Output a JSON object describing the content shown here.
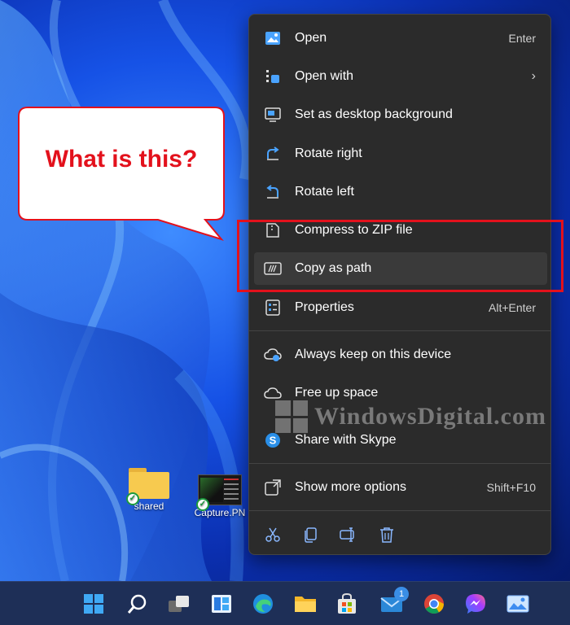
{
  "callout": {
    "text": "What is this?"
  },
  "desktop_icons": [
    {
      "label": "shared",
      "icon": "folder-icon"
    },
    {
      "label": "Capture.PN",
      "icon": "image-thumbnail-icon"
    }
  ],
  "context_menu": {
    "items": [
      {
        "label": "Open",
        "shortcut": "Enter",
        "icon": "image-icon"
      },
      {
        "label": "Open with",
        "shortcut": "",
        "icon": "open-with-icon",
        "submenu": true
      },
      {
        "label": "Set as desktop background",
        "shortcut": "",
        "icon": "desktop-background-icon"
      },
      {
        "label": "Rotate right",
        "shortcut": "",
        "icon": "rotate-right-icon"
      },
      {
        "label": "Rotate left",
        "shortcut": "",
        "icon": "rotate-left-icon"
      },
      {
        "label": "Compress to ZIP file",
        "shortcut": "",
        "icon": "zip-icon"
      },
      {
        "label": "Copy as path",
        "shortcut": "",
        "icon": "copy-path-icon",
        "highlighted": true
      },
      {
        "label": "Properties",
        "shortcut": "Alt+Enter",
        "icon": "properties-icon"
      },
      {
        "label": "Always keep on this device",
        "shortcut": "",
        "icon": "cloud-keep-icon"
      },
      {
        "label": "Free up space",
        "shortcut": "",
        "icon": "cloud-icon"
      },
      {
        "label": "Share with Skype",
        "shortcut": "",
        "icon": "skype-icon"
      },
      {
        "label": "Show more options",
        "shortcut": "Shift+F10",
        "icon": "more-options-icon"
      }
    ],
    "bottom_actions": [
      "cut-icon",
      "copy-icon",
      "rename-icon",
      "delete-icon"
    ]
  },
  "watermark": {
    "text": "WindowsDigital.com"
  },
  "taskbar": {
    "icons": [
      "start-icon",
      "search-icon",
      "task-view-icon",
      "widgets-icon",
      "edge-icon",
      "file-explorer-icon",
      "store-icon",
      "mail-icon",
      "chrome-icon",
      "messenger-icon",
      "photos-icon"
    ],
    "mail_badge": "1"
  },
  "colors": {
    "accent_red": "#e3111c",
    "menu_bg": "#2b2b2b",
    "taskbar_bg": "#1e2f57"
  }
}
